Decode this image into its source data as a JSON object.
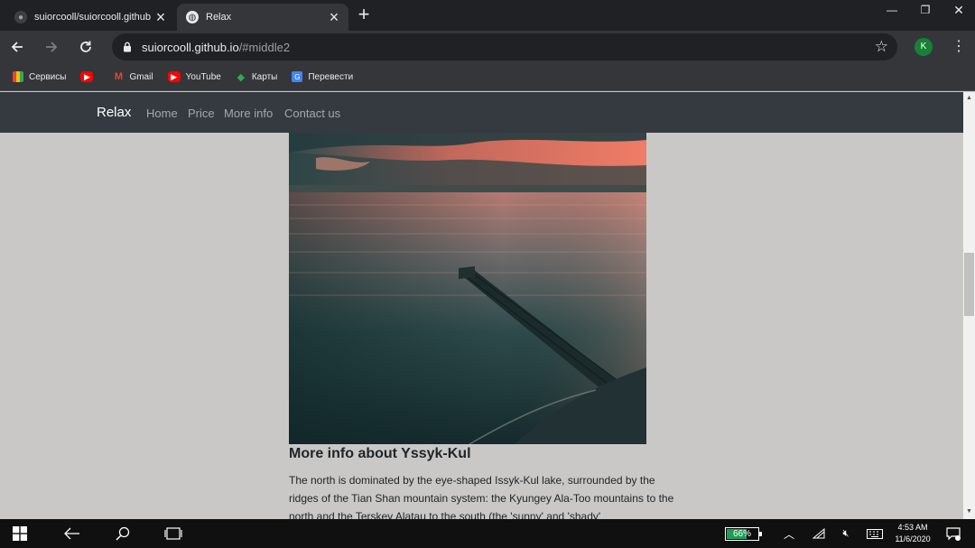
{
  "browser": {
    "tabs": [
      {
        "title": "suiorcooll/suiorcooll.github.io",
        "active": false,
        "favicon": "github-icon"
      },
      {
        "title": "Relax",
        "active": true,
        "favicon": "globe-icon"
      }
    ],
    "url_host": "suiorcooll.github.io",
    "url_path": "/#middle2",
    "profile_initial": "K",
    "bookmarks": [
      {
        "label": "Сервисы",
        "icon": "apps-grid-icon"
      },
      {
        "label": "",
        "icon": "youtube-icon"
      },
      {
        "label": "Gmail",
        "icon": "gmail-icon"
      },
      {
        "label": "YouTube",
        "icon": "youtube-icon"
      },
      {
        "label": "Карты",
        "icon": "maps-icon"
      },
      {
        "label": "Перевести",
        "icon": "translate-icon"
      }
    ]
  },
  "site": {
    "brand": "Relax",
    "nav": [
      "Home",
      "Price",
      "More info",
      "Contact us"
    ],
    "heading": "More info about Yssyk-Kul",
    "body_text": "The north is dominated by the eye-shaped Issyk-Kul lake, surrounded by the ridges of the Tian Shan mountain system: the Kyungey Ala-Too mountains to the north and the Terskey Alatau to the south (the 'sunny' and 'shady'"
  },
  "taskbar": {
    "battery_percent": "66%",
    "battery_level": 0.66,
    "time": "4:53 AM",
    "date": "11/6/2020"
  },
  "colors": {
    "site_navbar": "#343a40",
    "page_background": "#c9c8c6",
    "chrome_frame": "#202124",
    "chrome_toolbar": "#35363a"
  }
}
